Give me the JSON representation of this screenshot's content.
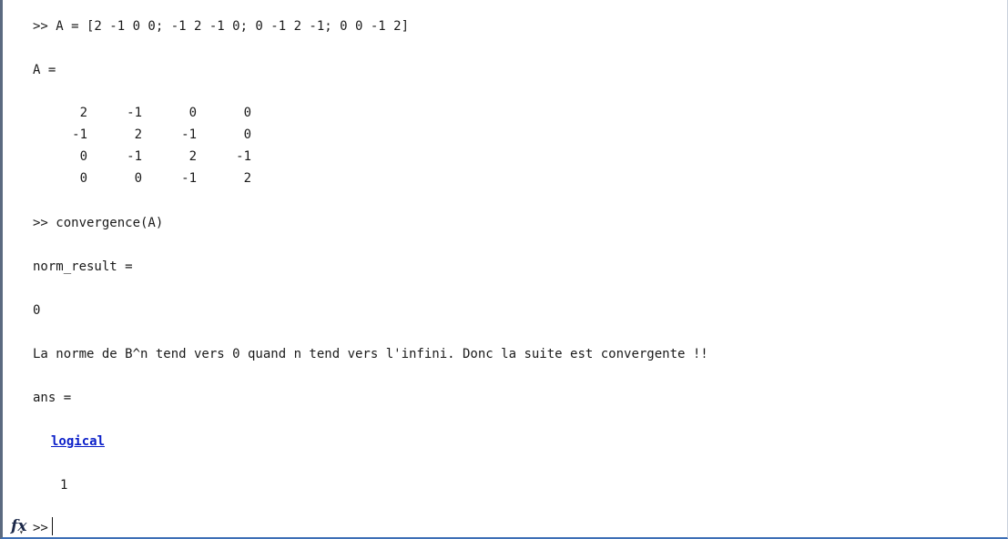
{
  "console": {
    "cmd1": ">> A = [2 -1 0 0; -1 2 -1 0; 0 -1 2 -1; 0 0 -1 2]",
    "var_a": "A =",
    "matrix": [
      [
        "2",
        "-1",
        "0",
        "0"
      ],
      [
        "-1",
        "2",
        "-1",
        "0"
      ],
      [
        "0",
        "-1",
        "2",
        "-1"
      ],
      [
        "0",
        "0",
        "-1",
        "2"
      ]
    ],
    "cmd2": ">> convergence(A)",
    "var_norm": "norm_result =",
    "norm_value": "0",
    "message": "La norme de B^n tend vers 0 quand n tend vers l'infini. Donc la suite est convergente !!",
    "var_ans": "ans =",
    "ans_type": "logical",
    "ans_value": "1"
  },
  "prompt": {
    "fx_label": "fx",
    "fx_caret": "▾",
    "symbol": ">>"
  },
  "colors": {
    "link": "#0b1fc9",
    "left_border": "#5b6a80",
    "bottom_border": "#3d6fb6"
  }
}
